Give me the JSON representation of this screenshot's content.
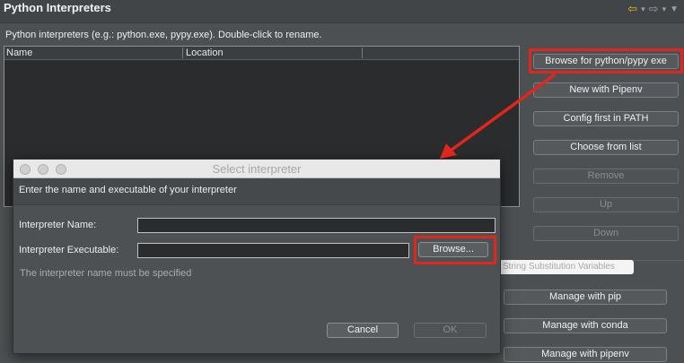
{
  "header": {
    "title": "Python Interpreters",
    "icons": [
      "back-arrow-icon",
      "forward-arrow-icon",
      "view-menu-icon"
    ]
  },
  "description": "Python interpreters (e.g.: python.exe, pypy.exe).   Double-click to rename.",
  "table": {
    "columns": [
      "Name",
      "Location"
    ],
    "rows": []
  },
  "buttons": {
    "browse": "Browse for python/pypy exe",
    "pipenv": "New with Pipenv",
    "config": "Config first in PATH",
    "choose": "Choose from list",
    "remove": "Remove",
    "up": "Up",
    "down": "Down"
  },
  "lower": {
    "var_button": "String Substitution Variables",
    "pip": "Manage with pip",
    "conda": "Manage with conda",
    "pipenv": "Manage with pipenv"
  },
  "dialog": {
    "title": "Select interpreter",
    "header": "Enter the name and executable of your interpreter",
    "name_label": "Interpreter Name:",
    "name_value": "",
    "exec_label": "Interpreter Executable:",
    "exec_value": "",
    "browse": "Browse...",
    "error": "The interpreter name must be specified",
    "cancel": "Cancel",
    "ok": "OK"
  },
  "annotation_color": "#e3261c"
}
